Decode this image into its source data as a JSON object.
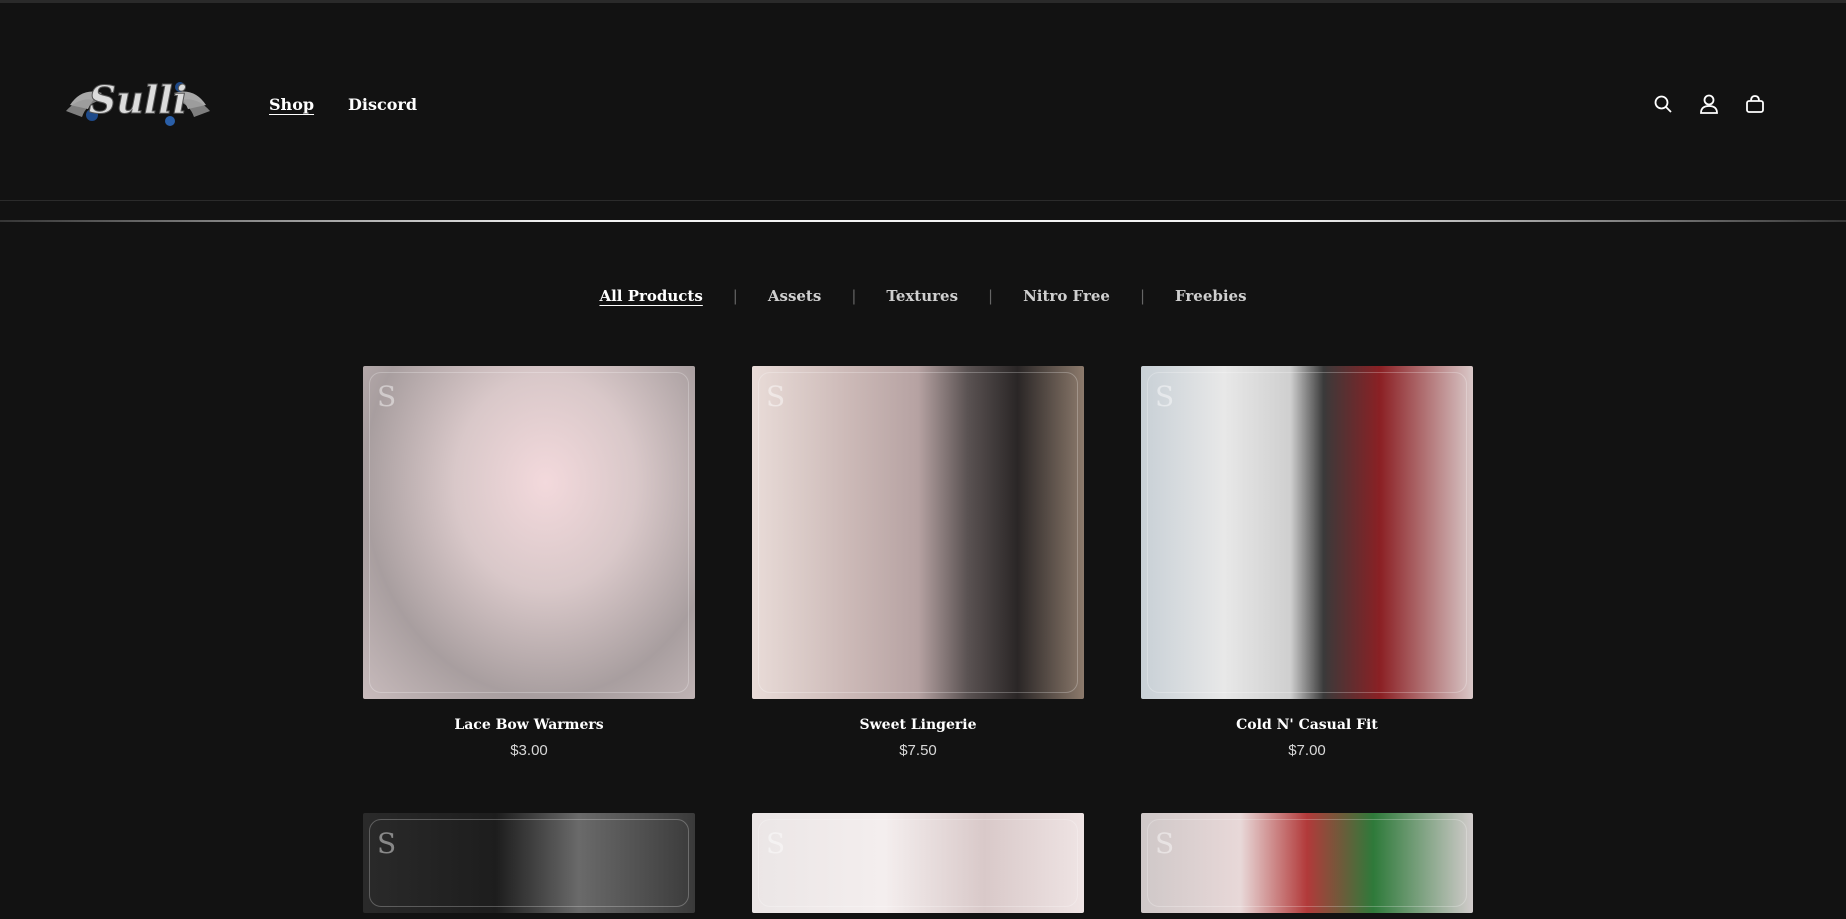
{
  "header": {
    "logo_text": "Sulli",
    "nav": [
      {
        "label": "Shop",
        "active": true
      },
      {
        "label": "Discord",
        "active": false
      }
    ],
    "icons": [
      "search-icon",
      "account-icon",
      "cart-icon"
    ]
  },
  "filters": [
    {
      "label": "All Products",
      "active": true
    },
    {
      "label": "Assets",
      "active": false
    },
    {
      "label": "Textures",
      "active": false
    },
    {
      "label": "Nitro Free",
      "active": false
    },
    {
      "label": "Freebies",
      "active": false
    }
  ],
  "products": [
    {
      "name": "Lace Bow Warmers",
      "price": "$3.00"
    },
    {
      "name": "Sweet Lingerie",
      "price": "$7.50"
    },
    {
      "name": "Cold N' Casual Fit",
      "price": "$7.00"
    },
    {
      "name": "",
      "price": ""
    },
    {
      "name": "",
      "price": ""
    },
    {
      "name": "",
      "price": ""
    }
  ],
  "watermark": "S",
  "colors": {
    "background": "#121212",
    "text": "#ffffff",
    "muted": "#d8d8d8"
  }
}
